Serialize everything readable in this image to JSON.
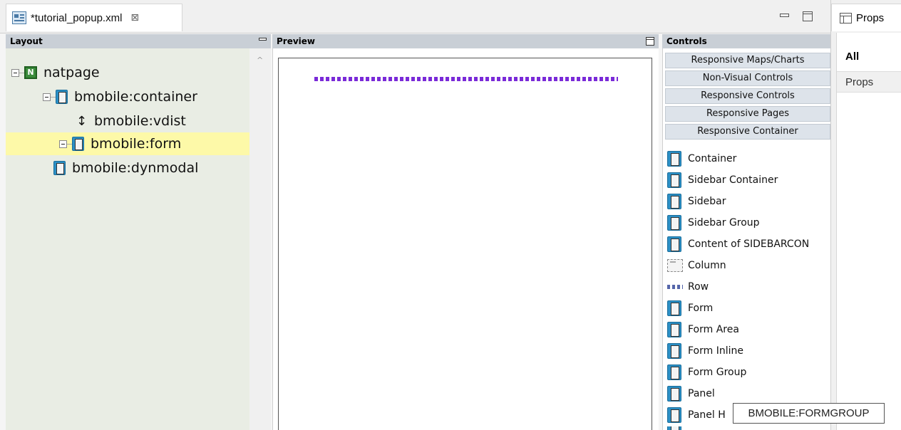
{
  "editor": {
    "tab_title": "*tutorial_popup.xml",
    "close_glyph": "⊠"
  },
  "properties": {
    "header_label": "Props",
    "tabs": [
      {
        "label": "All",
        "active": true
      },
      {
        "label": "Props",
        "active": false
      }
    ]
  },
  "layout_panel": {
    "title": "Layout",
    "tree": [
      {
        "label": "natpage",
        "icon": "natpage-icon",
        "expanded": true
      },
      {
        "label": "bmobile:container",
        "icon": "container-icon",
        "expanded": true
      },
      {
        "label": "bmobile:vdist",
        "icon": "vdist-icon"
      },
      {
        "label": "bmobile:form",
        "icon": "form-icon",
        "expanded": true,
        "selected": true
      },
      {
        "label": "bmobile:dynmodal",
        "icon": "dynmodal-icon"
      }
    ]
  },
  "preview_panel": {
    "title": "Preview"
  },
  "controls_panel": {
    "title": "Controls",
    "categories": [
      "Responsive Maps/Charts",
      "Non-Visual Controls",
      "Responsive Controls",
      "Responsive Pages",
      "Responsive Container"
    ],
    "items": [
      {
        "label": "Container",
        "icon": "container-icon"
      },
      {
        "label": "Sidebar Container",
        "icon": "container-icon"
      },
      {
        "label": "Sidebar",
        "icon": "container-icon"
      },
      {
        "label": "Sidebar Group",
        "icon": "container-icon"
      },
      {
        "label": "Content of SIDEBARCON",
        "icon": "container-icon"
      },
      {
        "label": "Column",
        "icon": "column-icon"
      },
      {
        "label": "Row",
        "icon": "row-icon"
      },
      {
        "label": "Form",
        "icon": "container-icon"
      },
      {
        "label": "Form Area",
        "icon": "container-icon"
      },
      {
        "label": "Form Inline",
        "icon": "container-icon"
      },
      {
        "label": "Form Group",
        "icon": "container-icon"
      },
      {
        "label": "Panel",
        "icon": "container-icon"
      },
      {
        "label": "Panel H",
        "icon": "container-icon"
      }
    ]
  },
  "tooltip": {
    "text": "BMOBILE:FORMGROUP"
  },
  "colors": {
    "selection": "#fdf9a8",
    "layout_bg": "#e9ede4",
    "panel_header": "#c9cfd6",
    "vdist_marker": "#7a2ad8",
    "category_button": "#dde3ea"
  }
}
